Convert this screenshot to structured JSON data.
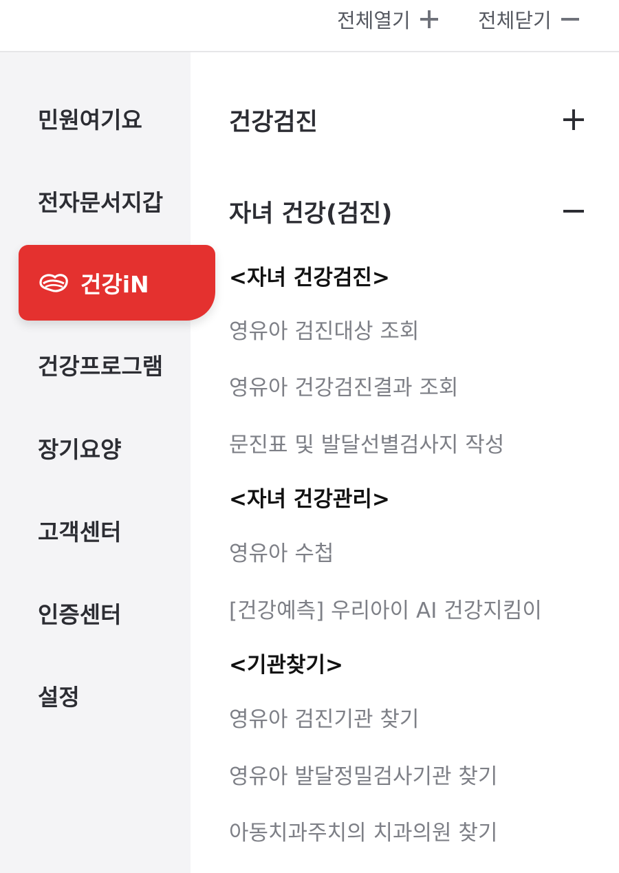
{
  "topbar": {
    "expand_all": "전체열기",
    "collapse_all": "전체닫기"
  },
  "sidebar": {
    "items": [
      {
        "label": "민원여기요"
      },
      {
        "label": "전자문서지갑"
      },
      {
        "label": "건강iN",
        "active": true
      },
      {
        "label": "건강프로그램"
      },
      {
        "label": "장기요양"
      },
      {
        "label": "고객센터"
      },
      {
        "label": "인증센터"
      },
      {
        "label": "설정"
      }
    ],
    "accent_color": "#e4312f"
  },
  "main": {
    "sections": [
      {
        "title": "건강검진",
        "state": "collapsed"
      },
      {
        "title": "자녀 건강(검진)",
        "state": "expanded"
      }
    ],
    "groups": [
      {
        "title": "<자녀 건강검진>",
        "links": [
          "영유아 검진대상 조회",
          "영유아 건강검진결과 조회",
          "문진표 및 발달선별검사지 작성"
        ]
      },
      {
        "title": "<자녀 건강관리>",
        "links": [
          "영유아 수첩",
          "[건강예측] 우리아이 AI 건강지킴이"
        ]
      },
      {
        "title": "<기관찾기>",
        "links": [
          "영유아 검진기관 찾기",
          "영유아 발달정밀검사기관 찾기",
          "아동치과주치의 치과의원 찾기"
        ]
      }
    ]
  }
}
